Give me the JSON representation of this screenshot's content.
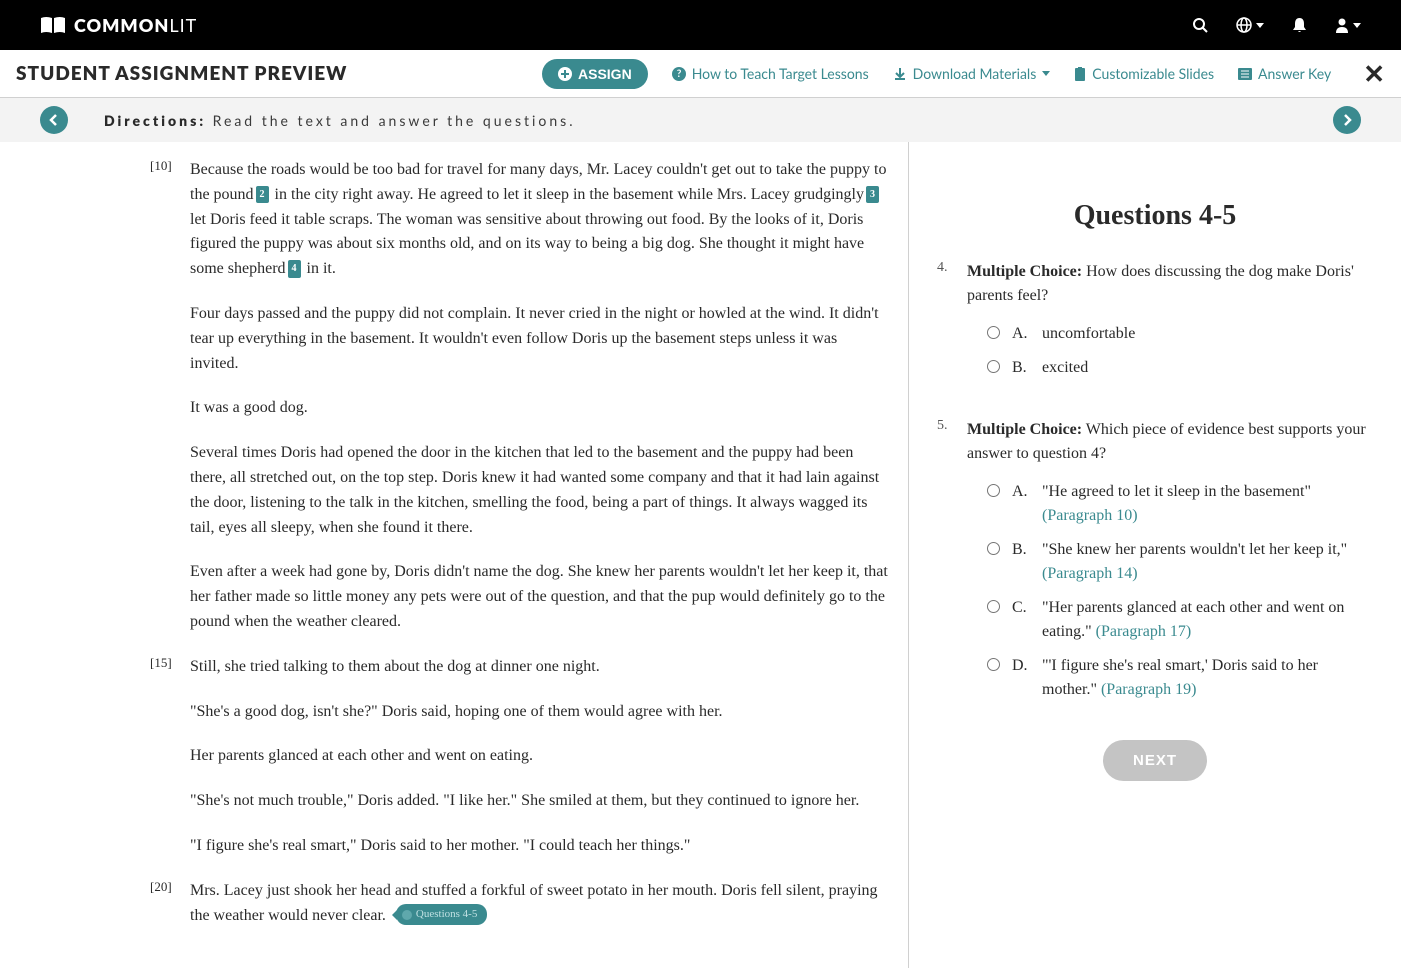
{
  "topnav": {
    "brand_bold": "COMMON",
    "brand_light": "LIT"
  },
  "secondbar": {
    "title": "STUDENT ASSIGNMENT PREVIEW",
    "assign": "ASSIGN",
    "how_to": "How to Teach Target Lessons",
    "download": "Download Materials",
    "slides": "Customizable Slides",
    "answer_key": "Answer Key"
  },
  "directions": {
    "label": "Directions:",
    "text": "Read the text and answer the questions."
  },
  "reading": {
    "paras": [
      {
        "num": "[10]",
        "text_a": "Because the roads would be too bad for travel for many days, Mr. Lacey couldn't get out to take the puppy to the pound",
        "fn1": "2",
        "text_b": " in the city right away. He agreed to let it sleep in the basement while Mrs. Lacey grudgingly",
        "fn2": "3",
        "text_c": " let Doris feed it table scraps. The woman was sensitive about throwing out food. By the looks of it, Doris figured the puppy was about six months old, and on its way to being a big dog. She thought it might have some shepherd",
        "fn3": "4",
        "text_d": " in it."
      },
      {
        "num": "",
        "text": "Four days passed and the puppy did not complain. It never cried in the night or howled at the wind. It didn't tear up everything in the basement. It wouldn't even follow Doris up the basement steps unless it was invited."
      },
      {
        "num": "",
        "text": "It was a good dog."
      },
      {
        "num": "",
        "text": "Several times Doris had opened the door in the kitchen that led to the basement and the puppy had been there, all stretched out, on the top step. Doris knew it had wanted some company and that it had lain against the door, listening to the talk in the kitchen, smelling the food, being a part of things. It always wagged its tail, eyes all sleepy, when she found it there."
      },
      {
        "num": "",
        "text": "Even after a week had gone by, Doris didn't name the dog. She knew her parents wouldn't let her keep it, that her father made so little money any pets were out of the question, and that the pup would definitely go to the pound when the weather cleared."
      },
      {
        "num": "[15]",
        "text": "Still, she tried talking to them about the dog at dinner one night."
      },
      {
        "num": "",
        "text": "\"She's a good dog, isn't she?\" Doris said, hoping one of them would agree with her."
      },
      {
        "num": "",
        "text": "Her parents glanced at each other and went on eating."
      },
      {
        "num": "",
        "text": "\"She's not much trouble,\" Doris added. \"I like her.\" She smiled at them, but they continued to ignore her."
      },
      {
        "num": "",
        "text": "\"I figure she's real smart,\" Doris said to her mother. \"I could teach her things.\""
      },
      {
        "num": "[20]",
        "text": "Mrs. Lacey just shook her head and stuffed a forkful of sweet potato in her mouth. Doris fell silent, praying the weather would never clear.",
        "pill": "Questions 4-5"
      }
    ]
  },
  "qpanel": {
    "heading": "Questions 4-5",
    "questions": [
      {
        "num": "4.",
        "label": "Multiple Choice:",
        "prompt": " How does discussing the dog make Doris' parents feel?",
        "options": [
          {
            "l": "A.",
            "t": "uncomfortable"
          },
          {
            "l": "B.",
            "t": "excited"
          }
        ]
      },
      {
        "num": "5.",
        "label": "Multiple Choice:",
        "prompt": " Which piece of evidence best supports your answer to question 4?",
        "options": [
          {
            "l": "A.",
            "t": "\"He agreed to let it sleep in the basement\" ",
            "p": "(Paragraph 10)"
          },
          {
            "l": "B.",
            "t": "\"She knew her parents wouldn't let her keep it,\" ",
            "p": "(Paragraph 14)"
          },
          {
            "l": "C.",
            "t": "\"Her parents glanced at each other and went on eating.\" ",
            "p": "(Paragraph 17)"
          },
          {
            "l": "D.",
            "t": "\"'I figure she's real smart,' Doris said to her mother.\" ",
            "p": "(Paragraph 19)"
          }
        ]
      }
    ],
    "next": "NEXT"
  }
}
